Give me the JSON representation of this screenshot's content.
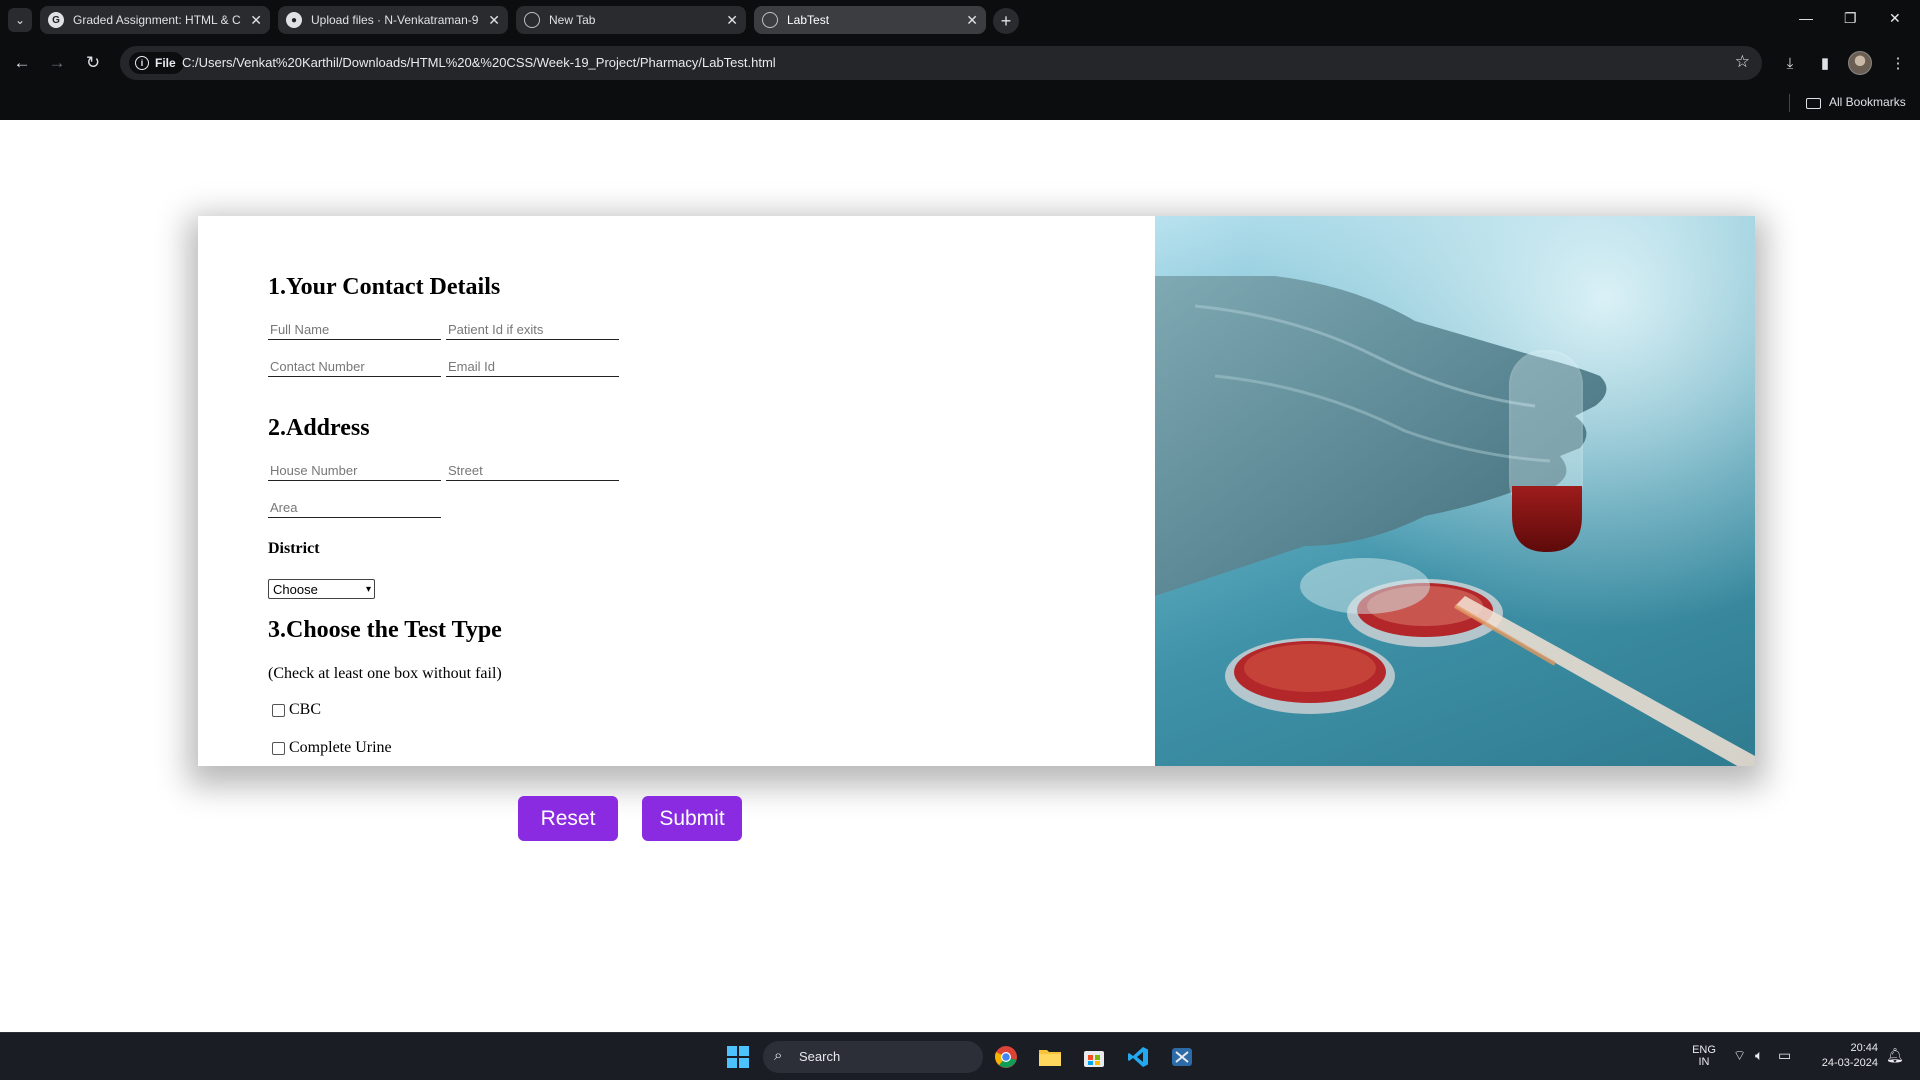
{
  "browser": {
    "tabs": [
      {
        "title": "Graded Assignment: HTML & C",
        "favicon": "google-g-icon",
        "active": false
      },
      {
        "title": "Upload files · N-Venkatraman-9",
        "favicon": "github-icon",
        "active": false
      },
      {
        "title": "New Tab",
        "favicon": "globe-icon",
        "active": false
      },
      {
        "title": "LabTest",
        "favicon": "globe-icon",
        "active": true
      }
    ],
    "site_chip": "File",
    "url": "C:/Users/Venkat%20Karthil/Downloads/HTML%20&%20CSS/Week-19_Project/Pharmacy/LabTest.html",
    "bookmarks_label": "All Bookmarks"
  },
  "form": {
    "section1_title": "1.Your Contact Details",
    "full_name_placeholder": "Full Name",
    "patient_id_placeholder": "Patient Id if exits",
    "contact_number_placeholder": "Contact Number",
    "email_placeholder": "Email Id",
    "section2_title": "2.Address",
    "house_number_placeholder": "House Number",
    "street_placeholder": "Street",
    "area_placeholder": "Area",
    "district_label": "District",
    "district_selected": "Choose",
    "section3_title": "3.Choose the Test Type",
    "test_note": "(Check at least one box without fail)",
    "tests": [
      {
        "label": "CBC",
        "checked": false
      },
      {
        "label": "Complete Urine",
        "checked": false
      }
    ]
  },
  "buttons": {
    "reset": "Reset",
    "submit": "Submit"
  },
  "colors": {
    "button_purple": "#8a2be2",
    "browser_dark": "#0c0d0e"
  },
  "taskbar": {
    "search_label": "Search",
    "lang_line1": "ENG",
    "lang_line2": "IN",
    "time": "20:44",
    "date": "24-03-2024"
  }
}
